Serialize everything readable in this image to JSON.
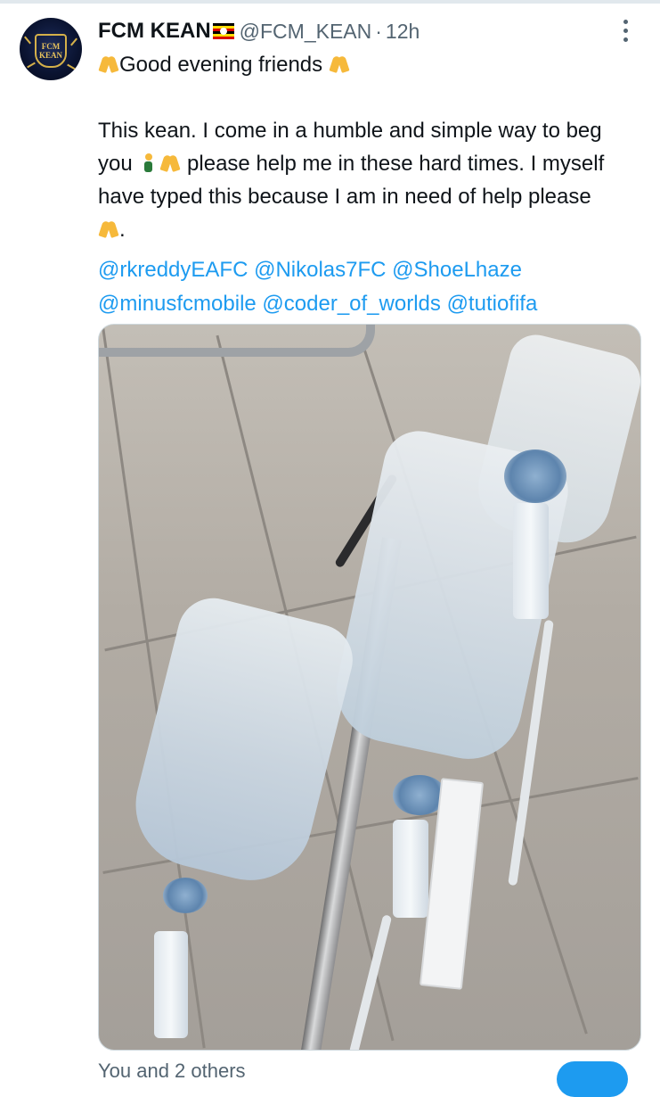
{
  "tweet": {
    "display_name": "FCM KEAN",
    "flag": "uganda-flag",
    "handle": "@FCM_KEAN",
    "separator": "·",
    "time": "12h",
    "avatar_text_top": "FCM",
    "avatar_text_bottom": "KEAN",
    "line1": "Good evening friends",
    "para_a": "This kean. I come in a humble and simple way to beg",
    "para_b_start": "you",
    "para_b_end": "please help me in these hard times. I myself",
    "para_c": "have typed this because I am in need of help please",
    "para_d_end": ".",
    "mentions_line1": [
      "@rkreddyEAFC",
      "@Nikolas7FC",
      "@ShoeLhaze"
    ],
    "mentions_line2": [
      "@minusfcmobile",
      "@coder_of_worlds",
      "@tutiofifa"
    ],
    "media_alt": "photo of IV drip bags hanging on a hospital stand"
  },
  "footer": {
    "likes_peek": "You and 2 others"
  },
  "colors": {
    "link": "#1d9bf0",
    "secondary": "#536471",
    "text": "#0f1419"
  },
  "icons": [
    "more-dots-icon",
    "folded-hands-emoji",
    "kneeling-person-emoji"
  ]
}
